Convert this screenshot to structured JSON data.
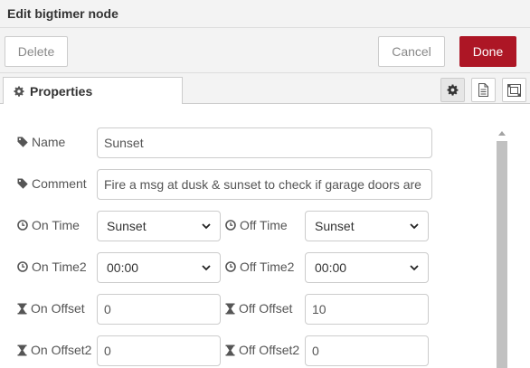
{
  "header": {
    "title": "Edit bigtimer node"
  },
  "toolbar": {
    "delete_label": "Delete",
    "cancel_label": "Cancel",
    "done_label": "Done"
  },
  "tabs": [
    {
      "label": "Properties"
    }
  ],
  "tab_buttons": [
    "gear-icon",
    "file-text-icon",
    "window-maximize-icon"
  ],
  "form": {
    "name": {
      "label": "Name",
      "value": "Sunset"
    },
    "comment": {
      "label": "Comment",
      "value": "Fire a msg at dusk & sunset to check if garage doors are o"
    },
    "on_time": {
      "label": "On Time",
      "value": "Sunset"
    },
    "off_time": {
      "label": "Off Time",
      "value": "Sunset"
    },
    "on_time2": {
      "label": "On Time2",
      "value": "00:00"
    },
    "off_time2": {
      "label": "Off Time2",
      "value": "00:00"
    },
    "on_offset": {
      "label": "On Offset",
      "value": "0"
    },
    "off_offset": {
      "label": "Off Offset",
      "value": "10"
    },
    "on_offset2": {
      "label": "On Offset2",
      "value": "0"
    },
    "off_offset2": {
      "label": "Off Offset2",
      "value": "0"
    }
  },
  "colors": {
    "done": "#ad1625",
    "header_bg": "#f3f3f3",
    "border": "#cccccc"
  }
}
